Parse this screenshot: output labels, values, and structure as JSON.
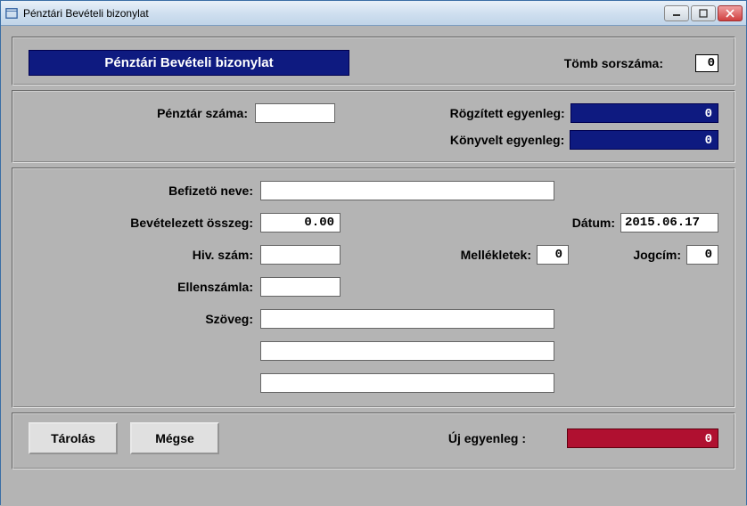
{
  "window": {
    "title": "Pénztári Bevételi bizonylat"
  },
  "header": {
    "title": "Pénztári Bevételi bizonylat",
    "tomb_label": "Tömb sorszáma:",
    "tomb_value": "0"
  },
  "balances": {
    "penztar_szama_label": "Pénztár száma:",
    "penztar_szama_value": "",
    "rogzitett_label": "Rögzített egyenleg:",
    "rogzitett_value": "0",
    "konyvelt_label": "Könyvelt egyenleg:",
    "konyvelt_value": "0"
  },
  "form": {
    "befizeto_label": "Befizetö neve:",
    "befizeto_value": "",
    "osszeg_label": "Bevételezett összeg:",
    "osszeg_value": "0.00",
    "datum_label": "Dátum:",
    "datum_value": "2015.06.17",
    "hiv_label": "Hiv. szám:",
    "hiv_value": "",
    "mellekletek_label": "Mellékletek:",
    "mellekletek_value": "0",
    "jogcim_label": "Jogcím:",
    "jogcim_value": "0",
    "ellenszamla_label": "Ellenszámla:",
    "ellenszamla_value": "",
    "szoveg_label": "Szöveg:",
    "szoveg_value1": "",
    "szoveg_value2": "",
    "szoveg_value3": ""
  },
  "footer": {
    "tarolas_label": "Tárolás",
    "megse_label": "Mégse",
    "uj_egyenleg_label": "Új egyenleg :",
    "uj_egyenleg_value": "0"
  }
}
